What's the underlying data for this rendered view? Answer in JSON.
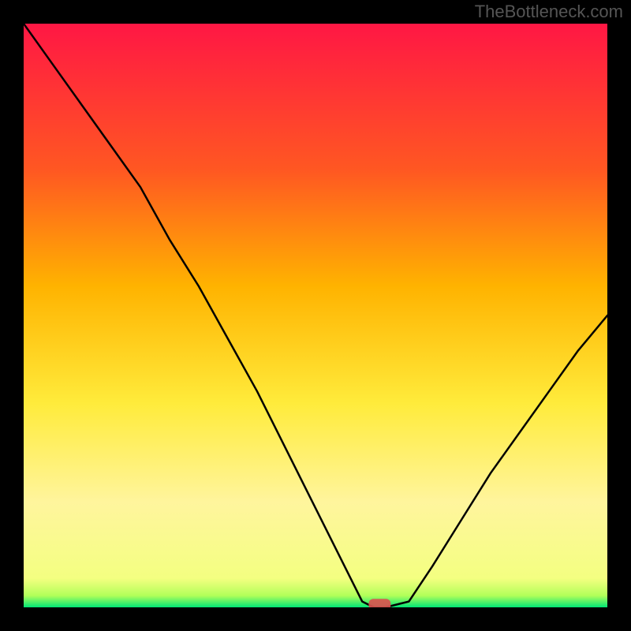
{
  "watermark": "TheBottleneck.com",
  "chart_data": {
    "type": "line",
    "title": "",
    "xlabel": "",
    "ylabel": "",
    "xlim": [
      0,
      100
    ],
    "ylim": [
      0,
      100
    ],
    "grid": false,
    "legend": false,
    "background_gradient": {
      "stops": [
        {
          "offset": 0,
          "color": "#ff1744"
        },
        {
          "offset": 25,
          "color": "#ff5722"
        },
        {
          "offset": 45,
          "color": "#ffb300"
        },
        {
          "offset": 65,
          "color": "#ffeb3b"
        },
        {
          "offset": 82,
          "color": "#fff59d"
        },
        {
          "offset": 95,
          "color": "#f4ff81"
        },
        {
          "offset": 98,
          "color": "#b2ff59"
        },
        {
          "offset": 100,
          "color": "#00e676"
        }
      ]
    },
    "series": [
      {
        "name": "bottleneck-curve",
        "x": [
          0,
          5,
          10,
          15,
          20,
          25,
          30,
          35,
          40,
          45,
          50,
          55,
          58,
          60,
          62,
          66,
          70,
          75,
          80,
          85,
          90,
          95,
          100
        ],
        "y": [
          100,
          93,
          86,
          79,
          72,
          63,
          55,
          46,
          37,
          27,
          17,
          7,
          1,
          0,
          0,
          1,
          7,
          15,
          23,
          30,
          37,
          44,
          50
        ]
      }
    ],
    "marker": {
      "name": "optimal-point",
      "x": 61,
      "y": 0.5,
      "color": "#d9534f",
      "shape": "rounded-rect"
    }
  }
}
